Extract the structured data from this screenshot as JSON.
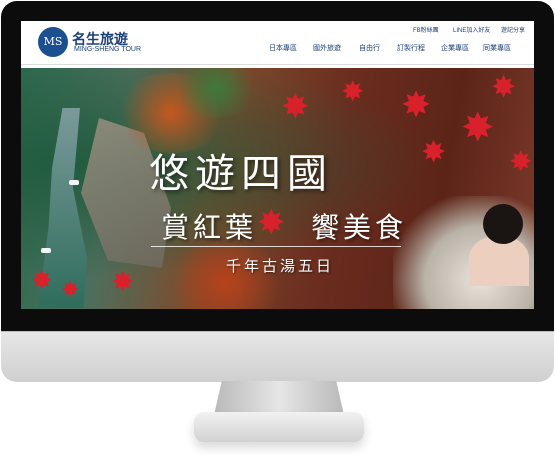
{
  "site": {
    "logo_mark": "MS",
    "logo_name": "名生旅遊",
    "logo_sub": "MING-SHENG TOUR"
  },
  "utility_links": [
    {
      "label": "FB粉絲團"
    },
    {
      "label": "LINE加入好友"
    },
    {
      "label": "遊記分享"
    }
  ],
  "nav": [
    {
      "label": "日本專區"
    },
    {
      "label": "國外旅遊"
    },
    {
      "label": "自由行"
    },
    {
      "label": "訂製行程"
    },
    {
      "label": "企業專區"
    },
    {
      "label": "同業專區"
    }
  ],
  "banner": {
    "title": "悠遊四國",
    "subtitle_left": "賞紅葉",
    "subtitle_right": "饗美食",
    "tagline": "千年古湯五日"
  },
  "colors": {
    "brand_blue": "#1c4f8f",
    "leaf_red": "#d8212a",
    "bezel": "#0c0c0c"
  },
  "icons": {
    "leaf": "maple-leaf-icon",
    "logo": "logo-mark-icon"
  }
}
